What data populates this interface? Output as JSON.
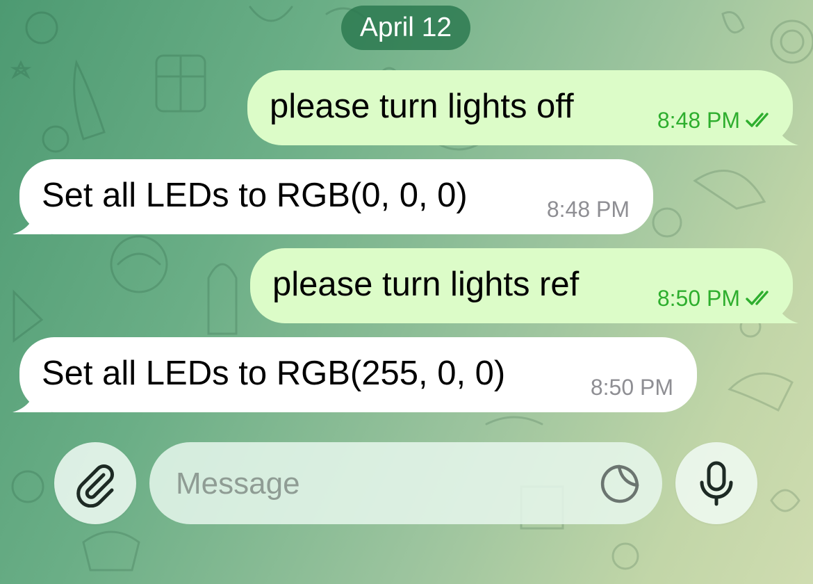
{
  "chat": {
    "date_label": "April 12",
    "messages": [
      {
        "direction": "outgoing",
        "text": "please turn lights off",
        "time": "8:48 PM",
        "status": "read"
      },
      {
        "direction": "incoming",
        "text": "Set all LEDs to RGB(0, 0, 0)",
        "time": "8:48 PM"
      },
      {
        "direction": "outgoing",
        "text": "please turn lights ref",
        "time": "8:50 PM",
        "status": "read"
      },
      {
        "direction": "incoming",
        "text": "Set all LEDs to RGB(255, 0, 0)",
        "time": "8:50 PM"
      }
    ]
  },
  "composer": {
    "placeholder": "Message",
    "attach_icon": "paperclip-icon",
    "sticker_icon": "sticker-icon",
    "mic_icon": "microphone-icon"
  },
  "colors": {
    "outgoing_bubble": "#dcfcc8",
    "incoming_bubble": "#ffffff",
    "outgoing_time": "#2eae2e",
    "incoming_time": "#8e8e93",
    "date_pill": "#2a784e"
  }
}
